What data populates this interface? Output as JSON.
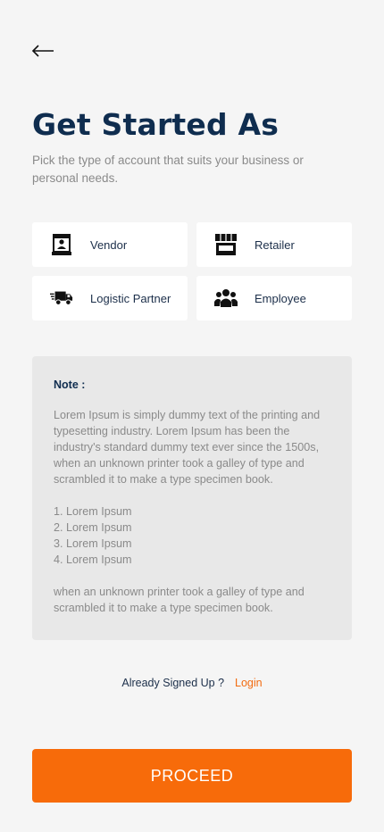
{
  "header": {
    "back_icon": "arrow-left-icon",
    "title": "Get Started As",
    "subtitle": "Pick the type of account that suits your business or personal needs."
  },
  "account_types": [
    {
      "label": "Vendor",
      "icon": "vendor-stall-icon"
    },
    {
      "label": "Retailer",
      "icon": "store-icon"
    },
    {
      "label": "Logistic Partner",
      "icon": "delivery-truck-icon"
    },
    {
      "label": "Employee",
      "icon": "users-group-icon"
    }
  ],
  "note": {
    "title": "Note :",
    "paragraph1": "Lorem Ipsum is simply dummy text of the printing and typesetting industry. Lorem Ipsum has been the industry's standard dummy text ever since the 1500s, when an unknown printer took a galley of type and scrambled it to make a type specimen book.",
    "list": [
      "1. Lorem Ipsum",
      "2. Lorem Ipsum",
      "3. Lorem Ipsum",
      "4. Lorem Ipsum"
    ],
    "paragraph2": "when an unknown printer took a galley of type and scrambled it to make a type specimen book."
  },
  "signin": {
    "question": "Already Signed Up ?",
    "login_label": "Login"
  },
  "proceed_label": "PROCEED",
  "colors": {
    "background": "#f5f5f5",
    "title": "#0f2d4f",
    "accent": "#f76b0a",
    "tile_bg": "#ffffff",
    "note_bg": "#e8e8e8"
  }
}
